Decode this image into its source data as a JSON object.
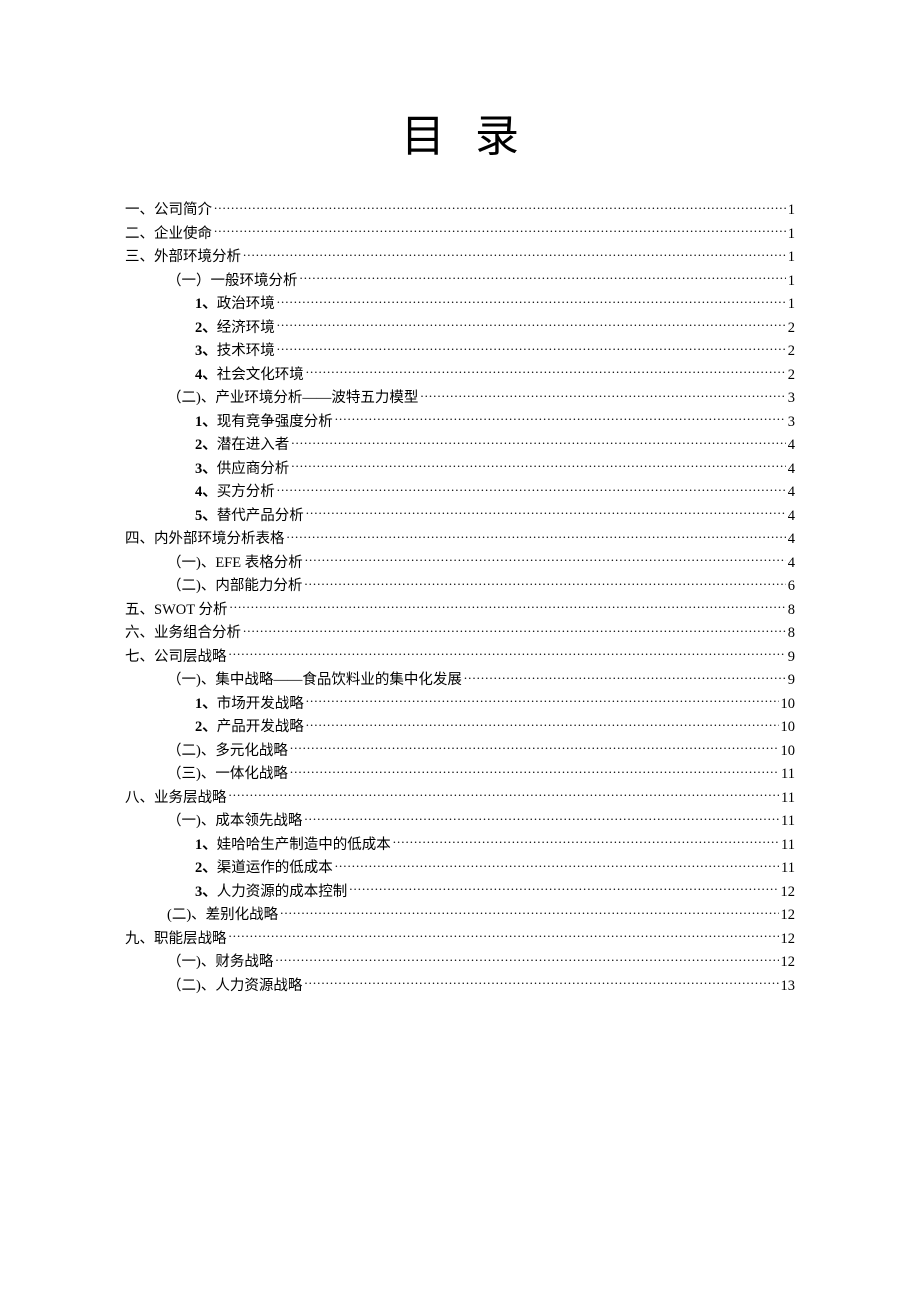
{
  "title": "目录",
  "entries": [
    {
      "level": 1,
      "label": "一、公司简介",
      "page": "1"
    },
    {
      "level": 1,
      "label": "二、企业使命",
      "page": "1"
    },
    {
      "level": 1,
      "label": "三、外部环境分析",
      "page": "1"
    },
    {
      "level": 2,
      "label": "（一）一般环境分析",
      "page": "1"
    },
    {
      "level": 3,
      "num": "1、",
      "label": "政治环境",
      "page": "1"
    },
    {
      "level": 3,
      "num": "2、",
      "label": "经济环境",
      "page": "2"
    },
    {
      "level": 3,
      "num": "3、",
      "label": "技术环境",
      "page": "2"
    },
    {
      "level": 3,
      "num": "4、",
      "label": "社会文化环境",
      "page": "2"
    },
    {
      "level": 2,
      "label": "（二)、产业环境分析——波特五力模型",
      "page": "3"
    },
    {
      "level": 3,
      "num": "1、",
      "label": "现有竞争强度分析",
      "page": "3"
    },
    {
      "level": 3,
      "num": "2、",
      "label": "潜在进入者",
      "page": "4"
    },
    {
      "level": 3,
      "num": "3、",
      "label": "供应商分析",
      "page": "4"
    },
    {
      "level": 3,
      "num": "4、",
      "label": "买方分析",
      "page": "4"
    },
    {
      "level": 3,
      "num": "5、",
      "label": "替代产品分析",
      "page": "4"
    },
    {
      "level": 1,
      "label": "四、内外部环境分析表格",
      "page": "4"
    },
    {
      "level": 2,
      "label": "（一)、EFE 表格分析",
      "page": "4"
    },
    {
      "level": 2,
      "label": "（二)、内部能力分析",
      "page": "6"
    },
    {
      "level": 1,
      "label": "五、SWOT 分析",
      "page": "8"
    },
    {
      "level": 1,
      "label": "六、业务组合分析",
      "page": "8"
    },
    {
      "level": 1,
      "label": "七、公司层战略",
      "page": "9"
    },
    {
      "level": 2,
      "label": "（一)、集中战略——食品饮料业的集中化发展",
      "page": "9"
    },
    {
      "level": 3,
      "num": "1、",
      "label": "市场开发战略",
      "page": "10"
    },
    {
      "level": 3,
      "num": "2、",
      "label": "产品开发战略",
      "page": "10"
    },
    {
      "level": 2,
      "label": "（二)、多元化战略",
      "page": "10"
    },
    {
      "level": 2,
      "label": "（三)、一体化战略",
      "page": "11"
    },
    {
      "level": 1,
      "label": "八、业务层战略",
      "page": "11"
    },
    {
      "level": 2,
      "label": "（一)、成本领先战略",
      "page": "11"
    },
    {
      "level": 3,
      "num": "1、",
      "label": "娃哈哈生产制造中的低成本",
      "page": "11"
    },
    {
      "level": 3,
      "num": "2、",
      "label": "渠道运作的低成本",
      "page": "11"
    },
    {
      "level": 3,
      "num": "3、",
      "label": "人力资源的成本控制",
      "page": "12"
    },
    {
      "level": 2,
      "label": "(二)、差别化战略",
      "page": "12"
    },
    {
      "level": 1,
      "label": "九、职能层战略",
      "page": "12"
    },
    {
      "level": 2,
      "label": "（一)、财务战略",
      "page": "12"
    },
    {
      "level": 2,
      "label": "（二)、人力资源战略",
      "page": "13"
    }
  ]
}
